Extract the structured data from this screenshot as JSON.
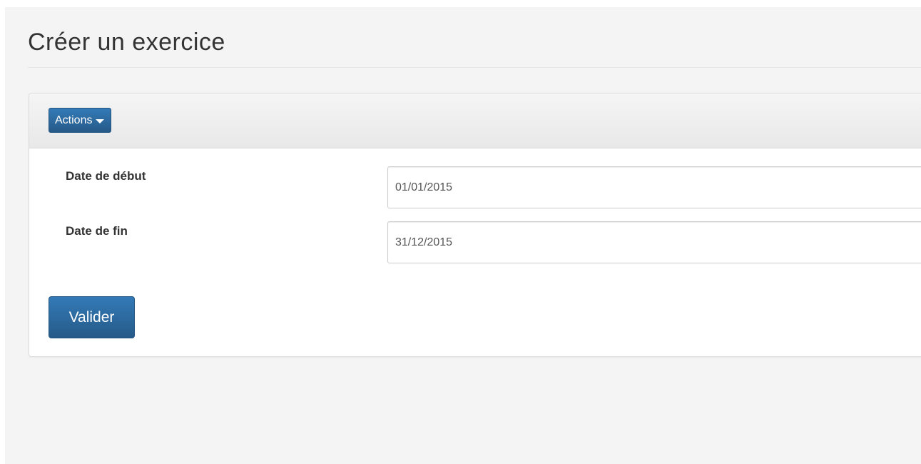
{
  "header": {
    "title": "Créer un exercice"
  },
  "panel": {
    "actions_label": "Actions"
  },
  "form": {
    "start_date": {
      "label": "Date de début",
      "value": "01/01/2015"
    },
    "end_date": {
      "label": "Date de fin",
      "value": "31/12/2015"
    },
    "submit_label": "Valider"
  },
  "icons": {
    "actions_dropdown": "caret-down-icon"
  },
  "colors": {
    "primary": "#337ab7",
    "background": "#f4f4f4"
  }
}
